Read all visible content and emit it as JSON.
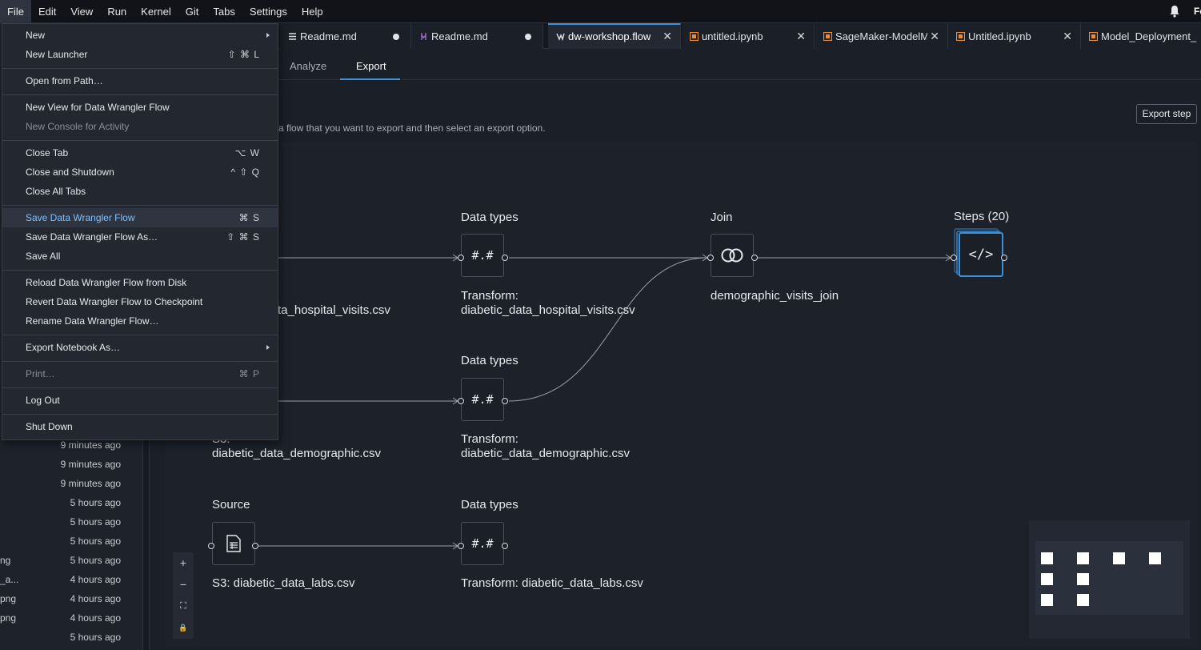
{
  "menubar": {
    "items": [
      "File",
      "Edit",
      "View",
      "Run",
      "Kernel",
      "Git",
      "Tabs",
      "Settings",
      "Help"
    ],
    "user_initial": "Fe"
  },
  "file_browser": {
    "rows": [
      {
        "name": "",
        "date": "9 minutes ago"
      },
      {
        "name": "",
        "date": "9 minutes ago"
      },
      {
        "name": "",
        "date": "9 minutes ago"
      },
      {
        "name": "",
        "date": "5 hours ago"
      },
      {
        "name": "",
        "date": "5 hours ago"
      },
      {
        "name": "",
        "date": "5 hours ago"
      },
      {
        "name": "ng",
        "date": "5 hours ago"
      },
      {
        "name": "_a...",
        "date": "4 hours ago"
      },
      {
        "name": "png",
        "date": "4 hours ago"
      },
      {
        "name": "png",
        "date": "4 hours ago"
      },
      {
        "name": "",
        "date": "5 hours ago"
      }
    ]
  },
  "tabs": [
    {
      "label": "Readme.md",
      "icon": "markdown-icon",
      "state": "dirty"
    },
    {
      "label": "Readme.md",
      "icon": "markdown-icon",
      "state": "dirty"
    },
    {
      "label": "dw-workshop.flow",
      "icon": "flow-icon",
      "state": "active"
    },
    {
      "label": "untitled.ipynb",
      "icon": "notebook-icon",
      "state": "close"
    },
    {
      "label": "SageMaker-ModelMc",
      "icon": "notebook-icon",
      "state": "close"
    },
    {
      "label": "Untitled.ipynb",
      "icon": "notebook-icon",
      "state": "close"
    },
    {
      "label": "Model_Deployment_",
      "icon": "notebook-icon",
      "state": "none"
    }
  ],
  "subtabs": [
    {
      "label": "Analyze",
      "active": false
    },
    {
      "label": "Export",
      "active": true
    }
  ],
  "export": {
    "instruction": "a flow that you want to export and then select an export option.",
    "export_step_label": "Export step"
  },
  "flow": {
    "nodes": {
      "dt1_title": "Data types",
      "dt1_glyph": "#.#",
      "dt1_label_1": "Transform:",
      "dt1_label_2": "diabetic_data_hospital_visits.csv",
      "src1_label": "ta_hospital_visits.csv",
      "dt2_title": "Data types",
      "dt2_glyph": "#.#",
      "dt2_label_1": "Transform:",
      "dt2_label_2": "diabetic_data_demographic.csv",
      "src2_label_1": "S3:",
      "src2_label_2": "diabetic_data_demographic.csv",
      "src3_title": "Source",
      "src3_label": "S3: diabetic_data_labs.csv",
      "dt3_title": "Data types",
      "dt3_glyph": "#.#",
      "dt3_label": "Transform: diabetic_data_labs.csv",
      "join_title": "Join",
      "join_label": "demographic_visits_join",
      "steps_title": "Steps (20)",
      "steps_glyph": "</>"
    }
  },
  "zoom": {
    "plus": "+",
    "minus": "−",
    "fit": "⛶",
    "lock": "🔒"
  },
  "file_menu": {
    "items": [
      {
        "label": "New",
        "shortcut": "",
        "submenu": true
      },
      {
        "label": "New Launcher",
        "shortcut": "⇧ ⌘ L"
      },
      {
        "label": "Open from Path…",
        "shortcut": ""
      },
      {
        "label": "New View for Data Wrangler Flow",
        "shortcut": ""
      },
      {
        "label": "New Console for Activity",
        "shortcut": "",
        "disabled": true
      },
      {
        "label": "Close Tab",
        "shortcut": "⌥ W"
      },
      {
        "label": "Close and Shutdown",
        "shortcut": "^ ⇧ Q"
      },
      {
        "label": "Close All Tabs",
        "shortcut": ""
      },
      {
        "label": "Save Data Wrangler Flow",
        "shortcut": "⌘ S",
        "highlighted": true
      },
      {
        "label": "Save Data Wrangler Flow As…",
        "shortcut": "⇧ ⌘ S"
      },
      {
        "label": "Save All",
        "shortcut": ""
      },
      {
        "label": "Reload Data Wrangler Flow from Disk",
        "shortcut": ""
      },
      {
        "label": "Revert Data Wrangler Flow to Checkpoint",
        "shortcut": ""
      },
      {
        "label": "Rename Data Wrangler Flow…",
        "shortcut": ""
      },
      {
        "label": "Export Notebook As…",
        "shortcut": "",
        "submenu": true
      },
      {
        "label": "Print…",
        "shortcut": "⌘ P",
        "disabled": true
      },
      {
        "label": "Log Out",
        "shortcut": ""
      },
      {
        "label": "Shut Down",
        "shortcut": ""
      }
    ]
  },
  "colors": {
    "accent": "#3d8fd6",
    "menu_highlight_text": "#7fc0ff",
    "background": "#1b1f28"
  }
}
